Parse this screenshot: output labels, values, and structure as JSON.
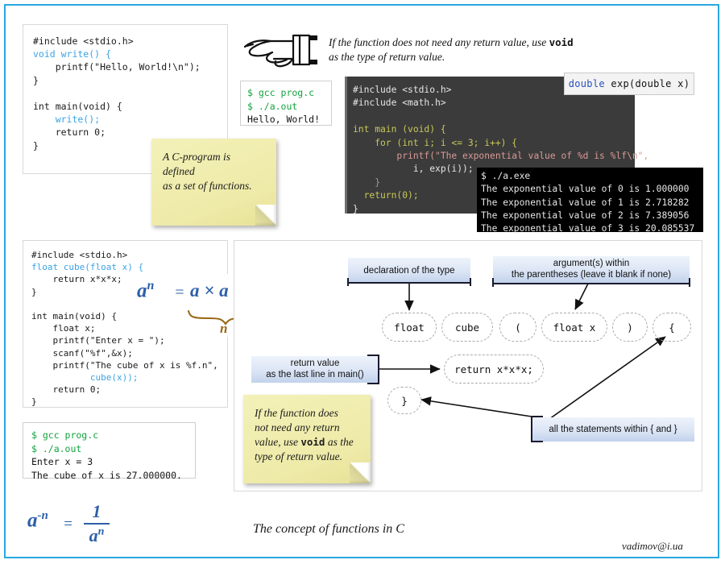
{
  "slide": {
    "title": "The concept of functions in C",
    "author_email": "vadimov@i.ua",
    "frame_color": "#29a8df"
  },
  "code_hello": {
    "lines": [
      "#include <stdio.h>",
      "void write() {",
      "    printf(\"Hello, World!\\n\");",
      "}",
      "",
      "int main(void) {",
      "    write();",
      "    return 0;",
      "}"
    ],
    "keyword_color": "#3aa3e3"
  },
  "terminal_hello": {
    "lines": [
      "$ gcc prog.c",
      "$ ./a.out",
      "Hello, World!"
    ],
    "prompt_color": "#12a33f"
  },
  "hint_void_top": {
    "text_before": "If the function does not need any return value, use ",
    "bold": "void",
    "text_after": "",
    "line2": "as the type of return value."
  },
  "sticky_program": {
    "line1": "A C-program is defined",
    "line2": "as a set of functions."
  },
  "code_exp": {
    "lines": [
      "#include <stdio.h>",
      "#include <math.h>",
      "",
      "int main (void) {",
      "    for (int i; i <= 3; i++) {",
      "        printf(\"The exponential value of %d is %lf\\n\",",
      "           i, exp(i));",
      "    }",
      "  return(0);",
      "}"
    ],
    "background": "#3b3b3b"
  },
  "tooltip_exp": {
    "type_kw": "double",
    "rest": " exp(double x)"
  },
  "terminal_exp": {
    "lines": [
      "$ ./a.exe",
      "The exponential value of 0 is 1.000000",
      "The exponential value of 1 is 2.718282",
      "The exponential value of 2 is 7.389056",
      "The exponential value of 3 is 20.085537"
    ]
  },
  "code_cube": {
    "lines": [
      "#include <stdio.h>",
      "float cube(float x) {",
      "    return x*x*x;",
      "}",
      "",
      "int main(void) {",
      "    float x;",
      "    printf(\"Enter x = \");",
      "    scanf(\"%f\",&x);",
      "    printf(\"The cube of x is %f.n\",",
      "           cube(x));",
      "    return 0;",
      "}"
    ]
  },
  "formula_power": {
    "base": "a",
    "exponent": "n",
    "equals": "=",
    "expansion": "a × a × ... × a",
    "brace_label": "n",
    "color": "#2d5fa8",
    "brace_color": "#9a6a15"
  },
  "formula_negative": {
    "base": "a",
    "exponent": "-n",
    "equals": "=",
    "numerator": "1",
    "denominator_base": "a",
    "denominator_exp": "n",
    "color": "#2d5fa8"
  },
  "terminal_cube": {
    "lines": [
      "$ gcc prog.c",
      "$ ./a.out",
      "Enter x = 3",
      "The cube of x is 27.000000."
    ],
    "prompt_color": "#12a33f"
  },
  "diagram": {
    "callouts": [
      {
        "id": "declaration-type",
        "text": "declaration of the type"
      },
      {
        "id": "arguments",
        "line1": "argument(s) within",
        "line2": "the parentheses (leave it blank if none)"
      },
      {
        "id": "return-value",
        "line1": "return value",
        "line2": "as the last line in main()"
      },
      {
        "id": "statements",
        "text": "all the statements within { and }"
      }
    ],
    "tokens": [
      {
        "id": "token-float",
        "label": "float"
      },
      {
        "id": "token-cube",
        "label": "cube"
      },
      {
        "id": "token-open-paren",
        "label": "("
      },
      {
        "id": "token-float-x",
        "label": "float x"
      },
      {
        "id": "token-close-paren",
        "label": ")"
      },
      {
        "id": "token-open-brace",
        "label": "{"
      },
      {
        "id": "token-return",
        "label": "return x*x*x;"
      },
      {
        "id": "token-close-brace",
        "label": "}"
      }
    ]
  },
  "sticky_void": {
    "line1": "If the function does",
    "line2": "not need any return",
    "line3_before": "value, use ",
    "line3_bold": "void",
    "line3_after": " as the",
    "line4": "type of return value."
  }
}
